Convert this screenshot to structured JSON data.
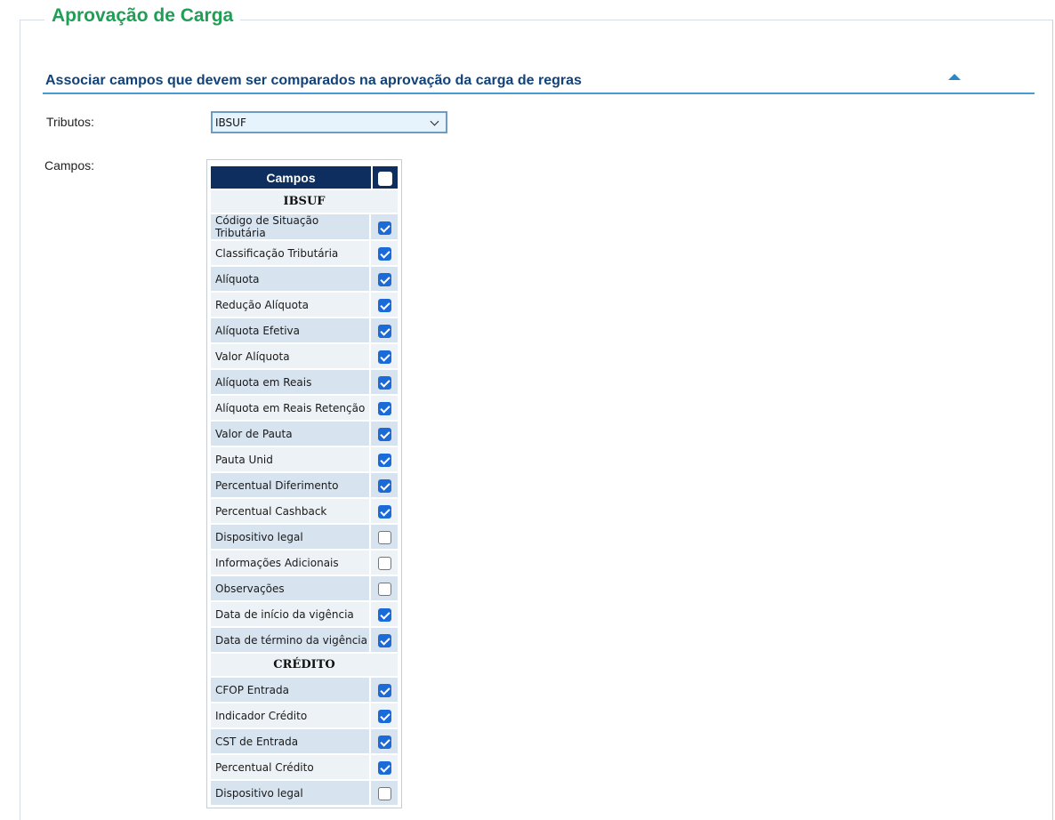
{
  "panel": {
    "title": "Aprovação de Carga"
  },
  "section": {
    "title": "Associar campos que devem ser comparados na aprovação da carga de regras",
    "collapse_icon": "triangle-up-icon"
  },
  "form": {
    "tributos_label": "Tributos:",
    "tributos_value": "IBSUF",
    "campos_label": "Campos:"
  },
  "table": {
    "header": "Campos",
    "select_all_checked": false,
    "groups": [
      {
        "name": "IBSUF",
        "rows": [
          {
            "label": "Código de Situação Tributária",
            "checked": true
          },
          {
            "label": "Classificação Tributária",
            "checked": true
          },
          {
            "label": "Alíquota",
            "checked": true
          },
          {
            "label": "Redução Alíquota",
            "checked": true
          },
          {
            "label": "Alíquota Efetiva",
            "checked": true
          },
          {
            "label": "Valor Alíquota",
            "checked": true
          },
          {
            "label": "Alíquota em Reais",
            "checked": true
          },
          {
            "label": "Alíquota em Reais Retenção",
            "checked": true
          },
          {
            "label": "Valor de Pauta",
            "checked": true
          },
          {
            "label": "Pauta Unid",
            "checked": true
          },
          {
            "label": "Percentual Diferimento",
            "checked": true
          },
          {
            "label": "Percentual Cashback",
            "checked": true
          },
          {
            "label": "Dispositivo legal",
            "checked": false
          },
          {
            "label": "Informações Adicionais",
            "checked": false
          },
          {
            "label": "Observações",
            "checked": false
          },
          {
            "label": "Data de início da vigência",
            "checked": true
          },
          {
            "label": "Data de término da vigência",
            "checked": true
          }
        ]
      },
      {
        "name": "CRÉDITO",
        "rows": [
          {
            "label": "CFOP Entrada",
            "checked": true
          },
          {
            "label": "Indicador Crédito",
            "checked": true
          },
          {
            "label": "CST de Entrada",
            "checked": true
          },
          {
            "label": "Percentual Crédito",
            "checked": true
          },
          {
            "label": "Dispositivo legal",
            "checked": false
          }
        ]
      }
    ]
  }
}
